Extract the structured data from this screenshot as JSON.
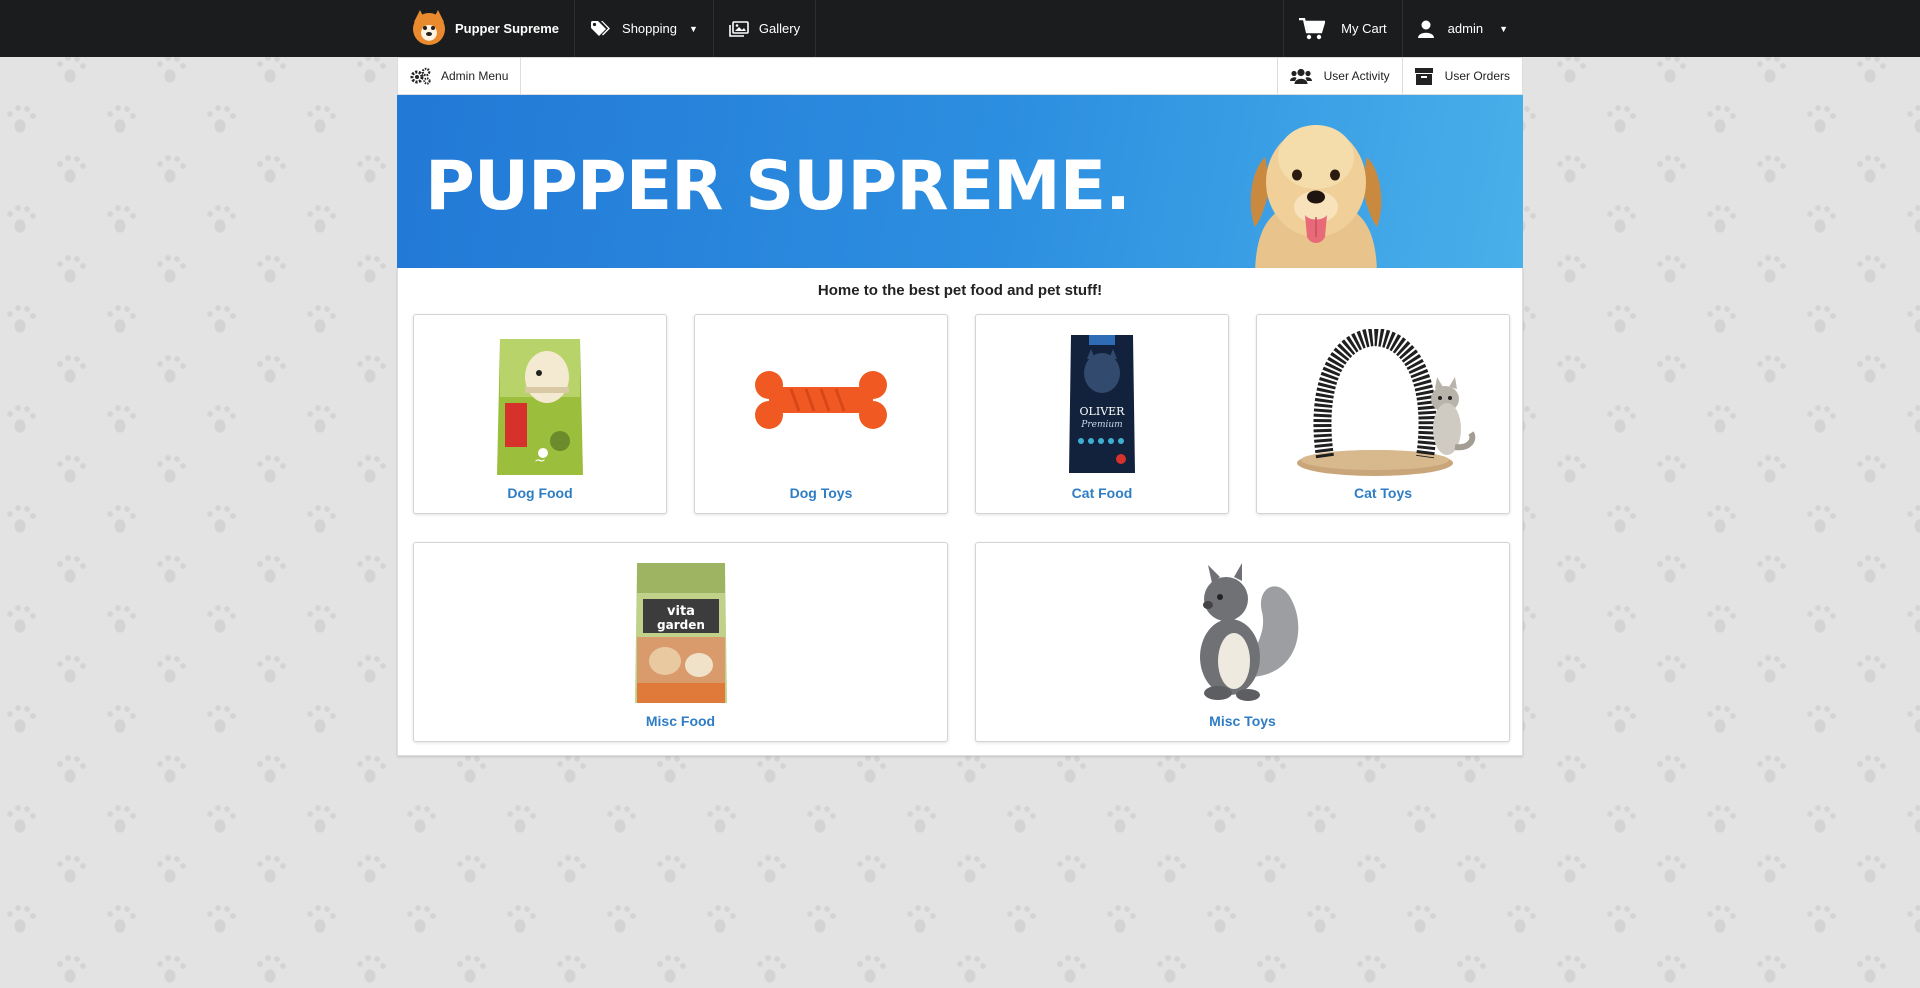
{
  "topnav": {
    "brand": "Pupper Supreme",
    "shopping": "Shopping",
    "gallery": "Gallery",
    "cart": "My Cart",
    "user": "admin"
  },
  "subnav": {
    "admin_menu": "Admin Menu",
    "user_activity": "User Activity",
    "user_orders": "User Orders"
  },
  "hero": {
    "title": "PUPPER SUPREME."
  },
  "main": {
    "tagline": "Home to the best pet food and pet stuff!",
    "categories": [
      {
        "label": "Dog Food"
      },
      {
        "label": "Dog Toys"
      },
      {
        "label": "Cat Food"
      },
      {
        "label": "Cat Toys"
      },
      {
        "label": "Misc Food"
      },
      {
        "label": "Misc Toys"
      }
    ]
  },
  "colors": {
    "navbar": "#1b1c1d",
    "hero_start": "#2279d6",
    "hero_end": "#49b0ea",
    "link": "#2f7dc4"
  },
  "icons": [
    "shiba-logo-icon",
    "tag-icon",
    "images-icon",
    "cart-icon",
    "user-icon",
    "cogs-icon",
    "users-icon",
    "box-icon"
  ]
}
